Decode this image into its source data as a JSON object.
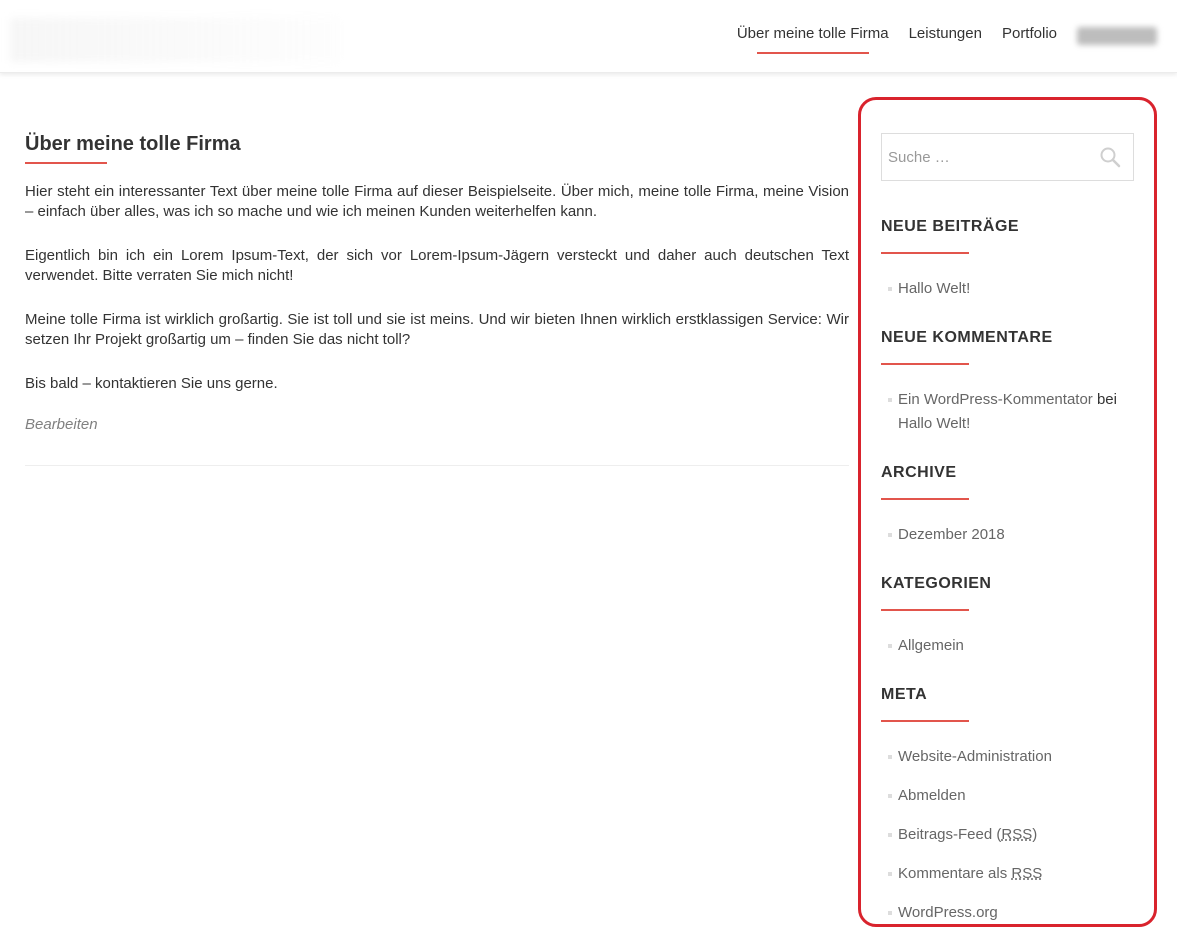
{
  "nav": {
    "items": [
      {
        "label": "Über meine tolle Firma"
      },
      {
        "label": "Leistungen"
      },
      {
        "label": "Portfolio"
      }
    ]
  },
  "main": {
    "title": "Über meine tolle Firma",
    "paragraphs": [
      "Hier steht ein interessanter Text über meine tolle Firma auf dieser Beispielseite. Über mich, meine tolle Firma, meine Vision – einfach über alles, was ich so mache und wie ich meinen Kunden weiterhelfen kann.",
      "Eigentlich bin ich ein Lorem Ipsum-Text, der sich vor Lorem-Ipsum-Jägern versteckt und daher auch deutschen Text verwendet. Bitte verraten Sie mich nicht!",
      "Meine tolle Firma ist wirklich großartig. Sie ist toll und sie ist meins. Und wir bieten Ihnen wirklich erstklassigen Service: Wir setzen Ihr Projekt großartig um – finden Sie das nicht toll?",
      "Bis bald – kontaktieren Sie uns gerne."
    ],
    "edit_label": "Bearbeiten"
  },
  "sidebar": {
    "search": {
      "placeholder": "Suche …",
      "value": ""
    },
    "recent_posts": {
      "title": "NEUE BEITRÄGE",
      "items": [
        "Hallo Welt!"
      ]
    },
    "recent_comments": {
      "title": "NEUE KOMMENTARE",
      "author": "Ein WordPress-Kommentator",
      "connector": " bei ",
      "post": "Hallo Welt!"
    },
    "archives": {
      "title": "ARCHIVE",
      "items": [
        "Dezember 2018"
      ]
    },
    "categories": {
      "title": "KATEGORIEN",
      "items": [
        "Allgemein"
      ]
    },
    "meta": {
      "title": "META",
      "site_admin": "Website-Administration",
      "logout": "Abmelden",
      "entries_feed_prefix": "Beitrags-Feed (",
      "rss_abbr": "RSS",
      "entries_feed_suffix": ")",
      "comments_feed_prefix": "Kommentare als ",
      "wordpress_org": "WordPress.org"
    }
  },
  "colors": {
    "accent": "#e2554c",
    "highlight_border": "#d9232d"
  },
  "icons": {
    "search": "search-icon"
  }
}
